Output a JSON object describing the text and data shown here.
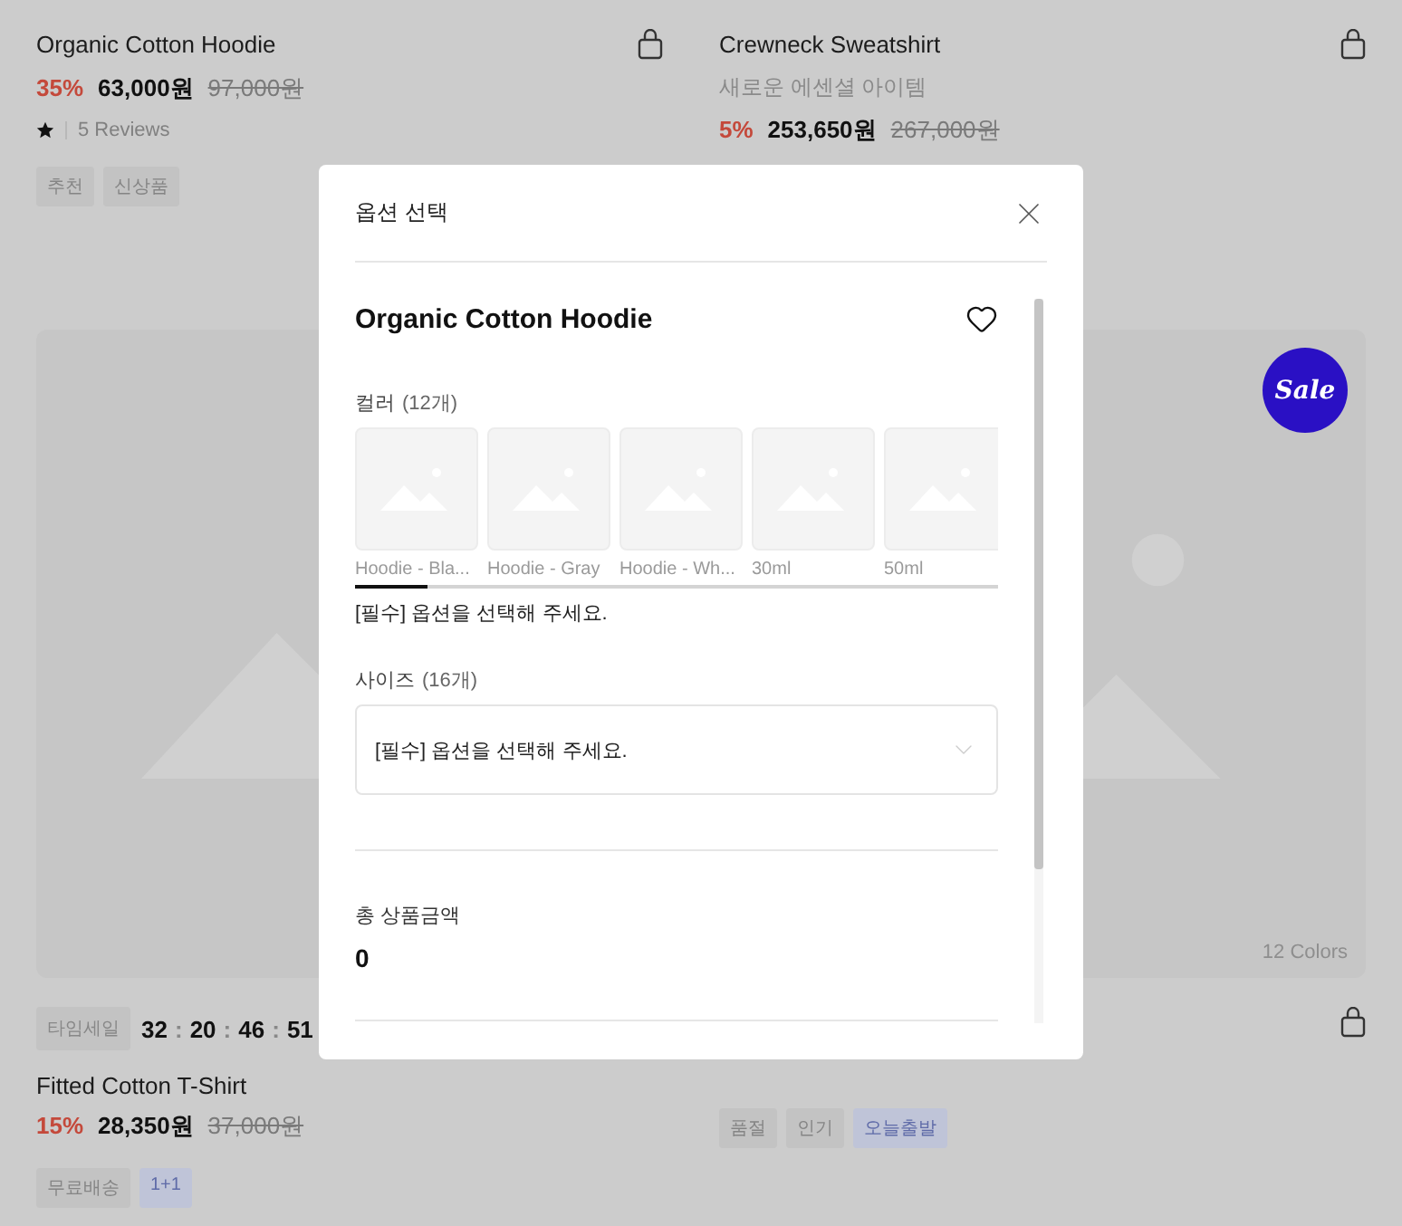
{
  "top_products": [
    {
      "title": "Organic Cotton Hoodie",
      "discount": "35%",
      "price": "63,000원",
      "original_price": "97,000원",
      "reviews": "5 Reviews",
      "tags": [
        {
          "label": "추천",
          "kind": "default"
        },
        {
          "label": "신상품",
          "kind": "default"
        }
      ]
    },
    {
      "title": "Crewneck Sweatshirt",
      "subtitle": "새로운 에센셜 아이템",
      "discount": "5%",
      "price": "253,650원",
      "original_price": "267,000원"
    }
  ],
  "banners": [
    {
      "kind": "plain"
    },
    {
      "kind": "sale",
      "badge": "Sale",
      "colors": "12 Colors"
    }
  ],
  "bottom_products": [
    {
      "kind": "timesale",
      "timer_label": "타임세일",
      "timer": [
        {
          "text": "32",
          "kind": "digits"
        },
        {
          "text": ":",
          "kind": "colon"
        },
        {
          "text": "20",
          "kind": "digits"
        },
        {
          "text": ":",
          "kind": "colon"
        },
        {
          "text": "46",
          "kind": "digits"
        },
        {
          "text": ":",
          "kind": "colon"
        },
        {
          "text": "51",
          "kind": "digits"
        }
      ],
      "title": "Fitted Cotton T-Shirt",
      "discount": "15%",
      "price": "28,350원",
      "original_price": "37,000원",
      "tags": [
        {
          "label": "무료배송",
          "kind": "default"
        },
        {
          "label": "1+1",
          "kind": "highlight"
        }
      ]
    },
    {
      "kind": "bag",
      "tags": [
        {
          "label": "품절",
          "kind": "default"
        },
        {
          "label": "인기",
          "kind": "default"
        },
        {
          "label": "오늘출발",
          "kind": "highlight"
        }
      ]
    }
  ],
  "modal": {
    "title": "옵션 선택",
    "product_name": "Organic Cotton Hoodie",
    "color_option": {
      "label": "컬러",
      "count": "(12개)",
      "swatches": [
        "Hoodie - Bla...",
        "Hoodie - Gray",
        "Hoodie - Wh...",
        "30ml",
        "50ml"
      ],
      "notice": "[필수] 옵션을 선택해 주세요."
    },
    "size_option": {
      "label": "사이즈",
      "count": "(16개)",
      "placeholder": "[필수] 옵션을 선택해 주세요."
    },
    "total": {
      "label": "총 상품금액",
      "value": "0"
    }
  }
}
